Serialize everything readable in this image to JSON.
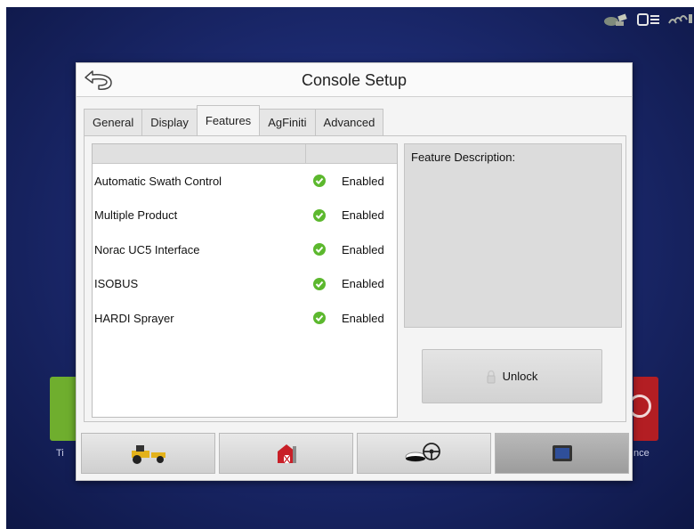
{
  "dialog": {
    "title": "Console Setup",
    "back_icon": "back-arrow-icon"
  },
  "tabs": [
    {
      "label": "General",
      "active": false
    },
    {
      "label": "Display",
      "active": false
    },
    {
      "label": "Features",
      "active": true
    },
    {
      "label": "AgFiniti",
      "active": false
    },
    {
      "label": "Advanced",
      "active": false
    }
  ],
  "features": [
    {
      "name": "Automatic Swath Control",
      "status": "Enabled"
    },
    {
      "name": "Multiple Product",
      "status": "Enabled"
    },
    {
      "name": "Norac UC5 Interface",
      "status": "Enabled"
    },
    {
      "name": "ISOBUS",
      "status": "Enabled"
    },
    {
      "name": "HARDI Sprayer",
      "status": "Enabled"
    }
  ],
  "description": {
    "label": "Feature Description:"
  },
  "unlock": {
    "label": "Unlock",
    "icon": "lock-icon"
  },
  "bottom_nav": [
    {
      "icon": "tractor-icon",
      "active": false
    },
    {
      "icon": "barn-icon",
      "active": false
    },
    {
      "icon": "guidance-steering-icon",
      "active": false
    },
    {
      "icon": "display-icon",
      "active": true
    }
  ],
  "background": {
    "left_tile_label": "Ti",
    "right_tile_label": "nce"
  },
  "colors": {
    "screen_bg": "#1c2a70",
    "enabled_check": "#5cb82e",
    "left_tile": "#6fae2e",
    "right_tile": "#b31e23"
  }
}
